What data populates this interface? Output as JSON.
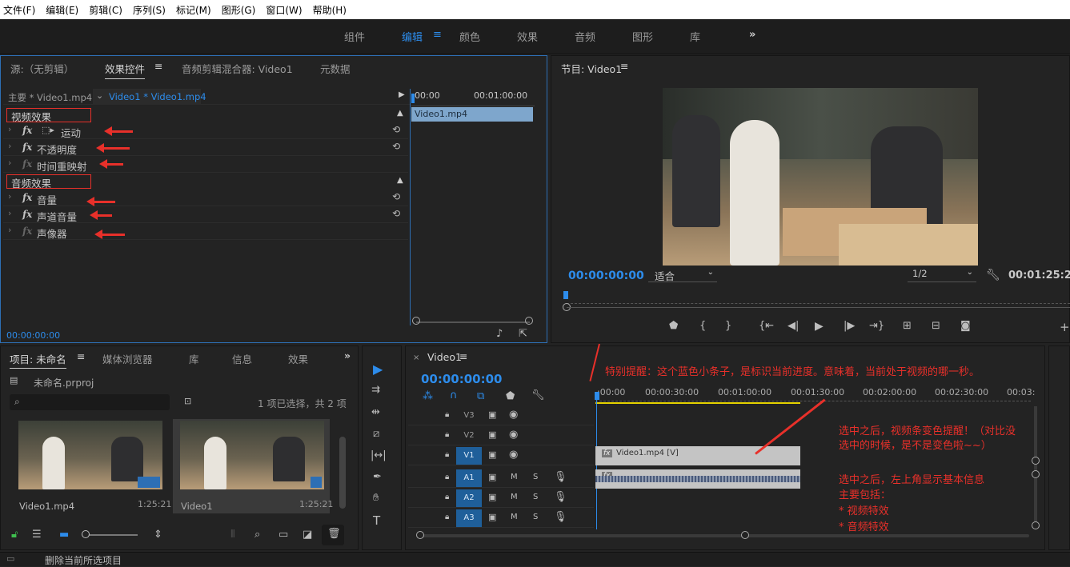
{
  "menu": [
    "文件(F)",
    "编辑(E)",
    "剪辑(C)",
    "序列(S)",
    "标记(M)",
    "图形(G)",
    "窗口(W)",
    "帮助(H)"
  ],
  "workspaces": [
    "组件",
    "编辑",
    "颜色",
    "效果",
    "音频",
    "图形",
    "库"
  ],
  "workspace_more": "»",
  "source_tabs": {
    "source": "源:（无剪辑）",
    "effects": "效果控件",
    "mixer": "音频剪辑混合器: Video1",
    "metadata": "元数据"
  },
  "ec": {
    "master": "主要 * Video1.mp4",
    "seq": "Video1 * Video1.mp4",
    "t0": "00:00",
    "t1": "00:01:00:00",
    "clip": "Video1.mp4",
    "video_section": "视频效果",
    "audio_section": "音频效果",
    "timecode": "00:00:00:00",
    "video_effects": [
      "运动",
      "不透明度",
      "时间重映射"
    ],
    "audio_effects": [
      "音量",
      "声道音量",
      "声像器"
    ]
  },
  "program": {
    "title": "节目: Video1",
    "timecode": "00:00:00:00",
    "fit": "适合",
    "quality": "1/2",
    "duration": "00:01:25:21"
  },
  "project": {
    "tabs": [
      "项目: 未命名",
      "媒体浏览器",
      "库",
      "信息",
      "效果"
    ],
    "file": "未命名.prproj",
    "selection": "1 项已选择，共 2 项",
    "items": [
      {
        "name": "Video1.mp4",
        "dur": "1:25:21"
      },
      {
        "name": "Video1",
        "dur": "1:25:21"
      }
    ]
  },
  "timeline": {
    "title": "Video1",
    "timecode": "00:00:00:00",
    "ticks": [
      ":00:00",
      "00:00:30:00",
      "00:01:00:00",
      "00:01:30:00",
      "00:02:00:00",
      "00:02:30:00",
      "00:03:"
    ],
    "video_tracks": [
      "V3",
      "V2",
      "V1"
    ],
    "audio_tracks": [
      "A1",
      "A2",
      "A3"
    ],
    "clip_v": "Video1.mp4 [V]"
  },
  "annotations": {
    "note1": "特别提醒：这个蓝色小条子，是标识当前进度。意味着，当前处于视频的哪一秒。",
    "note2a": "选中之后，视频条变色提醒！（对比没",
    "note2b": "选中的时候，是不是变色啦~~）",
    "note3a": "选中之后，左上角显示基本信息",
    "note3b": "主要包括：",
    "note3c": "* 视频特效",
    "note3d": "* 音频特效"
  },
  "status": "删除当前所选项目",
  "colors": {
    "accent": "#2d8ceb",
    "annotation": "#e8302a"
  }
}
